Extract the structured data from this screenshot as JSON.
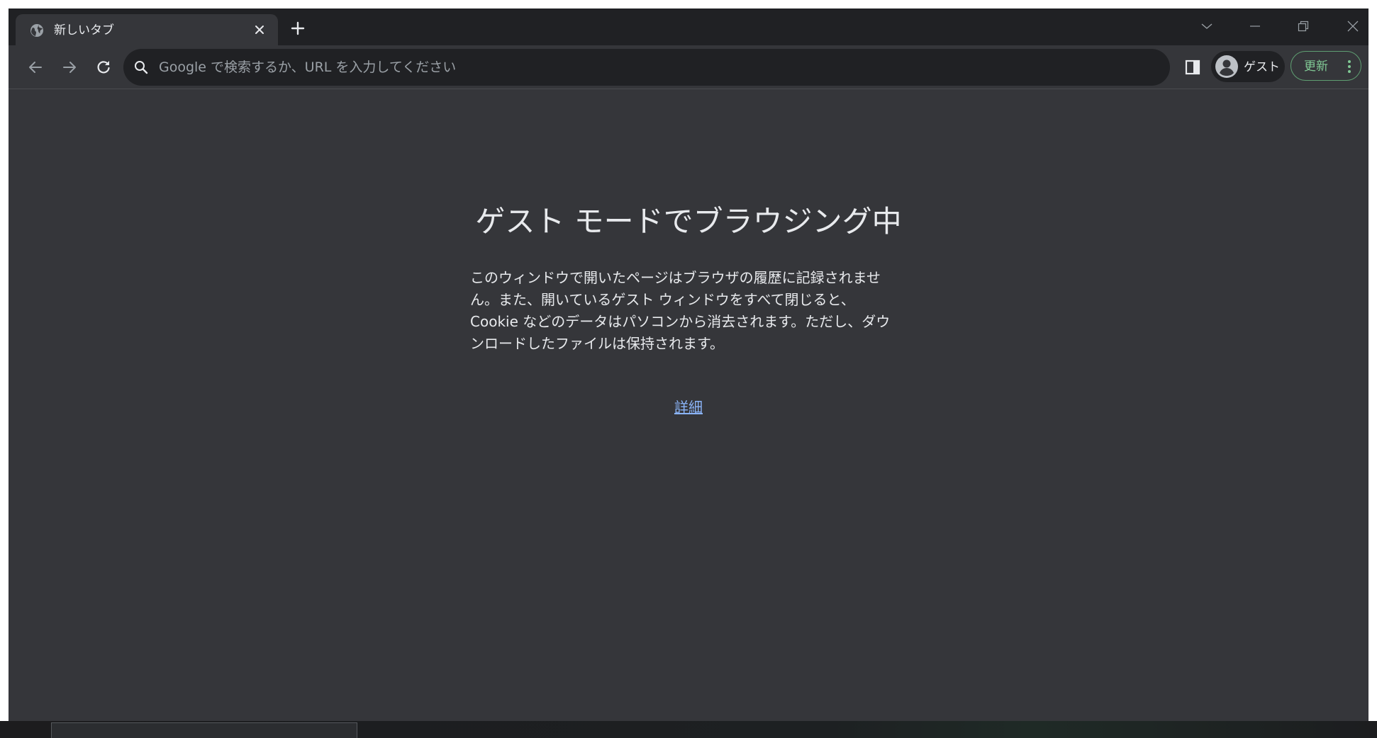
{
  "tab": {
    "title": "新しいタブ",
    "icon": "globe-icon"
  },
  "toolbar": {
    "omnibox_placeholder": "Google で検索するか、URL を入力してください",
    "profile_label": "ゲスト",
    "update_label": "更新"
  },
  "content": {
    "heading": "ゲスト モードでブラウジング中",
    "description": "このウィンドウで開いたページはブラウザの履歴に記録されません。また、開いているゲスト ウィンドウをすべて閉じると、Cookie などのデータはパソコンから消去されます。ただし、ダウンロードしたファイルは保持されます。",
    "learn_more": "詳細"
  },
  "colors": {
    "frame": "#202124",
    "surface": "#35363a",
    "text": "#e8eaed",
    "link": "#8ab4f8",
    "update_accent": "#81c995"
  }
}
